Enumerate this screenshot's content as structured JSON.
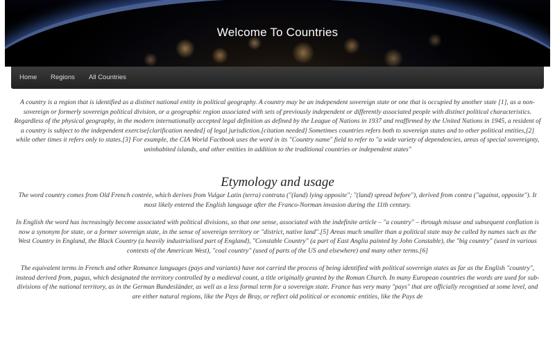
{
  "banner": {
    "title": "Welcome To Countries"
  },
  "nav": {
    "items": [
      {
        "label": "Home"
      },
      {
        "label": "Regions"
      },
      {
        "label": "All Countries"
      }
    ]
  },
  "content": {
    "intro": "A country is a region that is identified as a distinct national entity in political geography. A country may be an independent sovereign state or one that is occupied by another state [1], as a non-sovereign or formerly sovereign political division, or a geographic region associated with sets of previously independent or differently associated people with distinct political characteristics. Regardless of the physical geography, in the modern internationally accepted legal definition as defined by the League of Nations in 1937 and reaffirmed by the United Nations in 1945, a resident of a country is subject to the independent exercise[clarification needed] of legal jurisdiction.[citation needed] Sometimes countries refers both to sovereign states and to other political entities,[2] while other times it refers only to states.[3] For example, the CIA World Factbook uses the word in its \"Country name\" field to refer to \"a wide variety of dependencies, areas of special sovereignty, uninhabited islands, and other entities in addition to the traditional countries or independent states\"",
    "heading": "Etymology and usage",
    "paragraphs": [
      "The word country comes from Old French contrée, which derives from Vulgar Latin (terra) contrata (\"(land) lying opposite\"; \"(land) spread before\"), derived from contra (\"against, opposite\"). It most likely entered the English language after the Franco-Norman invasion during the 11th century.",
      "In English the word has increasingly become associated with political divisions, so that one sense, associated with the indefinite article – \"a country\" – through misuse and subsequent conflation is now a synonym for state, or a former sovereign state, in the sense of sovereign territory or \"district, native land\".[5] Areas much smaller than a political state may be called by names such as the West Country in England, the Black Country (a heavily industrialised part of England), \"Constable Country\" (a part of East Anglia painted by John Constable), the \"big country\" (used in various contexts of the American West), \"coal country\" (used of parts of the US and elsewhere) and many other terms.[6]",
      "The equivalent terms in French and other Romance languages (pays and variants) have not carried the process of being identified with political sovereign states as far as the English \"country\", instead derived from, pagus, which designated the territory controlled by a medieval count, a title originally granted by the Roman Church. In many European countries the words are used for sub-divisions of the national territory, as in the German Bundesländer, as well as a less formal term for a sovereign state. France has very many \"pays\" that are officially recognised at some level, and are either natural regions, like the Pays de Bray, or reflect old political or economic entities, like the Pays de"
    ]
  }
}
